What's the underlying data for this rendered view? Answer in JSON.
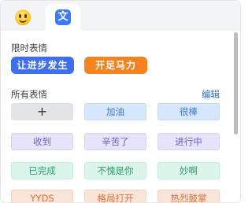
{
  "tabs": [
    {
      "id": "emoji",
      "icon": "smiley-emoji-icon"
    },
    {
      "id": "text",
      "icon_char": "文",
      "icon": "text-sticker-icon"
    }
  ],
  "limited": {
    "label": "限时表情",
    "items": [
      {
        "text": "让进步发生",
        "color": "#3d6ff0"
      },
      {
        "text": "开足马力",
        "color": "#f5831f"
      }
    ]
  },
  "all": {
    "label": "所有表情",
    "edit_label": "编辑",
    "chips": [
      {
        "text": "+",
        "style": "gray"
      },
      {
        "text": "加油",
        "style": "blue"
      },
      {
        "text": "很棒",
        "style": "blue"
      },
      {
        "text": "收到",
        "style": "purple"
      },
      {
        "text": "辛苦了",
        "style": "purple"
      },
      {
        "text": "进行中",
        "style": "purple"
      },
      {
        "text": "已完成",
        "style": "green"
      },
      {
        "text": "不愧是你",
        "style": "green"
      },
      {
        "text": "妙啊",
        "style": "green"
      },
      {
        "text": "YYDS",
        "style": "orange"
      },
      {
        "text": "格局打开",
        "style": "orange"
      },
      {
        "text": "热烈鼓掌",
        "style": "orange"
      }
    ]
  }
}
